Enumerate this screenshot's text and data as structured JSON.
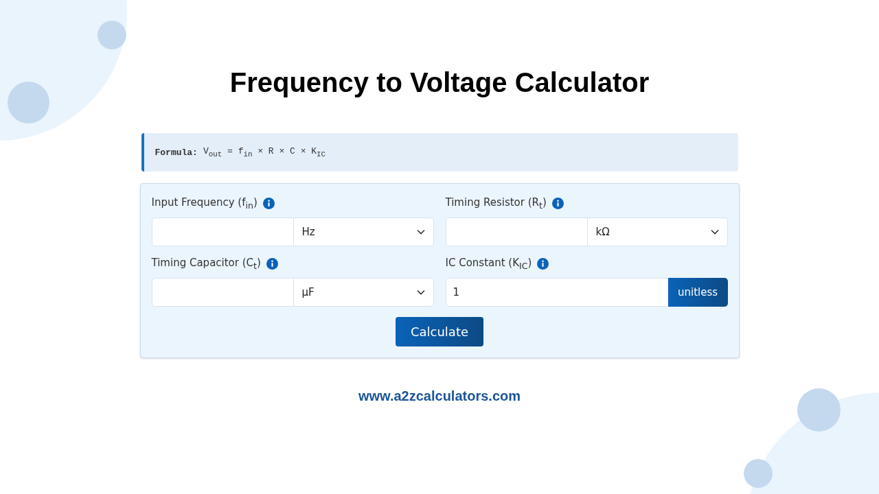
{
  "title": "Frequency to Voltage Calculator",
  "formula": {
    "label": "Formula:",
    "expression": "V$_{out}$ = f$_{in}$ × R × C × K$_{IC}$"
  },
  "fields": [
    {
      "label": "Input Frequency (f$_{in}$)",
      "kind": "select",
      "unit": "Hz"
    },
    {
      "label": "Timing Resistor (R$_{t}$)",
      "kind": "select",
      "unit": "kΩ"
    },
    {
      "label": "Timing Capacitor (C$_{t}$)",
      "kind": "select",
      "unit": "µF"
    },
    {
      "label": "IC Constant (K$_{IC}$)",
      "kind": "fixed",
      "value": "1",
      "unit": "unitless"
    }
  ],
  "button": "Calculate",
  "footer": "www.a2zcalculators.com"
}
